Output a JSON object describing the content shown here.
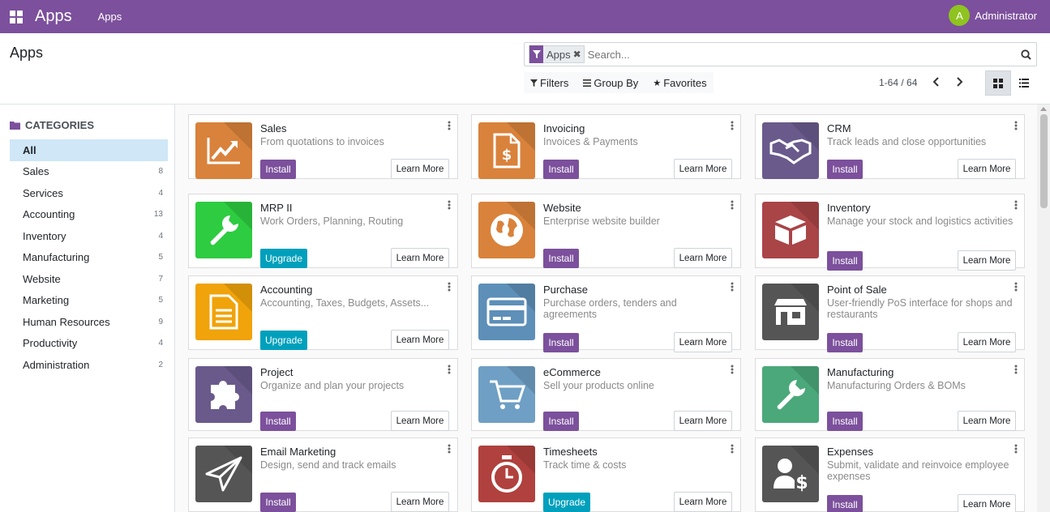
{
  "navbar": {
    "brand": "Apps",
    "menu_item": "Apps",
    "user_initial": "A",
    "user_name": "Administrator",
    "color": "#7c509c"
  },
  "control_panel": {
    "title": "Apps",
    "facet_label": "Apps",
    "search_placeholder": "Search...",
    "filters_label": "Filters",
    "group_by_label": "Group By",
    "favorites_label": "Favorites",
    "pager": "1-64 / 64"
  },
  "sidebar": {
    "header": "CATEGORIES",
    "items": [
      {
        "label": "All",
        "count": "",
        "active": true
      },
      {
        "label": "Sales",
        "count": "8"
      },
      {
        "label": "Services",
        "count": "4"
      },
      {
        "label": "Accounting",
        "count": "13"
      },
      {
        "label": "Inventory",
        "count": "4"
      },
      {
        "label": "Manufacturing",
        "count": "5"
      },
      {
        "label": "Website",
        "count": "7"
      },
      {
        "label": "Marketing",
        "count": "5"
      },
      {
        "label": "Human Resources",
        "count": "9"
      },
      {
        "label": "Productivity",
        "count": "4"
      },
      {
        "label": "Administration",
        "count": "2"
      }
    ]
  },
  "apps": [
    {
      "name": "Sales",
      "desc": "From quotations to invoices",
      "action": "Install",
      "learn": "Learn More",
      "color": "#d9823b",
      "icon": "chart-trend-icon"
    },
    {
      "name": "Invoicing",
      "desc": "Invoices & Payments",
      "action": "Install",
      "learn": "Learn More",
      "color": "#d9823b",
      "icon": "invoice-dollar-icon"
    },
    {
      "name": "CRM",
      "desc": "Track leads and close opportunities",
      "action": "Install",
      "learn": "Learn More",
      "color": "#6a5a8c",
      "icon": "handshake-icon"
    },
    {
      "name": "MRP II",
      "desc": "Work Orders, Planning, Routing",
      "action": "Upgrade",
      "learn": "Learn More",
      "color": "#2ecc40",
      "icon": "wrench-icon"
    },
    {
      "name": "Website",
      "desc": "Enterprise website builder",
      "action": "Install",
      "learn": "Learn More",
      "color": "#d9823b",
      "icon": "globe-icon"
    },
    {
      "name": "Inventory",
      "desc": "Manage your stock and logistics activities",
      "action": "Install",
      "learn": "Learn More",
      "color": "#a94447",
      "icon": "box-icon"
    },
    {
      "name": "Accounting",
      "desc": "Accounting, Taxes, Budgets, Assets...",
      "action": "Upgrade",
      "learn": "Learn More",
      "color": "#f0a30a",
      "icon": "document-icon"
    },
    {
      "name": "Purchase",
      "desc": "Purchase orders, tenders and agreements",
      "action": "Install",
      "learn": "Learn More",
      "color": "#5d8fb8",
      "icon": "credit-card-icon"
    },
    {
      "name": "Point of Sale",
      "desc": "User-friendly PoS interface for shops and restaurants",
      "action": "Install",
      "learn": "Learn More",
      "color": "#555555",
      "icon": "shop-icon"
    },
    {
      "name": "Project",
      "desc": "Organize and plan your projects",
      "action": "Install",
      "learn": "Learn More",
      "color": "#6a5a8c",
      "icon": "puzzle-icon"
    },
    {
      "name": "eCommerce",
      "desc": "Sell your products online",
      "action": "Install",
      "learn": "Learn More",
      "color": "#6f9fc4",
      "icon": "cart-icon"
    },
    {
      "name": "Manufacturing",
      "desc": "Manufacturing Orders & BOMs",
      "action": "Install",
      "learn": "Learn More",
      "color": "#4ba87a",
      "icon": "wrench-icon"
    },
    {
      "name": "Email Marketing",
      "desc": "Design, send and track emails",
      "action": "Install",
      "learn": "Learn More",
      "color": "#555555",
      "icon": "paper-plane-icon"
    },
    {
      "name": "Timesheets",
      "desc": "Track time & costs",
      "action": "Upgrade",
      "learn": "Learn More",
      "color": "#b0413e",
      "icon": "stopwatch-icon"
    },
    {
      "name": "Expenses",
      "desc": "Submit, validate and reinvoice employee expenses",
      "action": "Install",
      "learn": "Learn More",
      "color": "#555555",
      "icon": "user-dollar-icon"
    }
  ]
}
